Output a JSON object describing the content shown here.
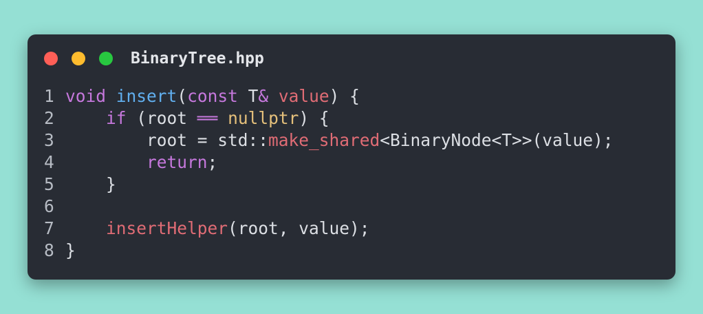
{
  "window": {
    "title": "BinaryTree.hpp",
    "traffic_lights": {
      "close": "#ff5f57",
      "minimize": "#febc2e",
      "maximize": "#28c840"
    }
  },
  "colors": {
    "background": "#95e0d4",
    "editor": "#282c34",
    "keyword": "#c678dd",
    "function": "#61afef",
    "variable": "#e06c75",
    "literal": "#e5c07b",
    "text": "#dcdfe4"
  },
  "code": {
    "lines": [
      {
        "number": "1",
        "tokens": [
          [
            "kw",
            "void"
          ],
          [
            "plain",
            " "
          ],
          [
            "fn",
            "insert"
          ],
          [
            "plain",
            "("
          ],
          [
            "kw",
            "const"
          ],
          [
            "plain",
            " T"
          ],
          [
            "kw",
            "&"
          ],
          [
            "plain",
            " "
          ],
          [
            "var",
            "value"
          ],
          [
            "plain",
            ") {"
          ]
        ]
      },
      {
        "number": "2",
        "tokens": [
          [
            "plain",
            "    "
          ],
          [
            "kw",
            "if"
          ],
          [
            "plain",
            " (root "
          ],
          [
            "kw",
            "══"
          ],
          [
            "plain",
            " "
          ],
          [
            "lit",
            "nullptr"
          ],
          [
            "plain",
            ") {"
          ]
        ]
      },
      {
        "number": "3",
        "tokens": [
          [
            "plain",
            "        root = std::"
          ],
          [
            "var",
            "make_shared"
          ],
          [
            "plain",
            "<BinaryNode<T>>(value);"
          ]
        ]
      },
      {
        "number": "4",
        "tokens": [
          [
            "plain",
            "        "
          ],
          [
            "kw",
            "return"
          ],
          [
            "plain",
            ";"
          ]
        ]
      },
      {
        "number": "5",
        "tokens": [
          [
            "plain",
            "    }"
          ]
        ]
      },
      {
        "number": "6",
        "tokens": []
      },
      {
        "number": "7",
        "tokens": [
          [
            "plain",
            "    "
          ],
          [
            "var",
            "insertHelper"
          ],
          [
            "plain",
            "(root, value);"
          ]
        ]
      },
      {
        "number": "8",
        "tokens": [
          [
            "plain",
            "}"
          ]
        ]
      }
    ]
  }
}
